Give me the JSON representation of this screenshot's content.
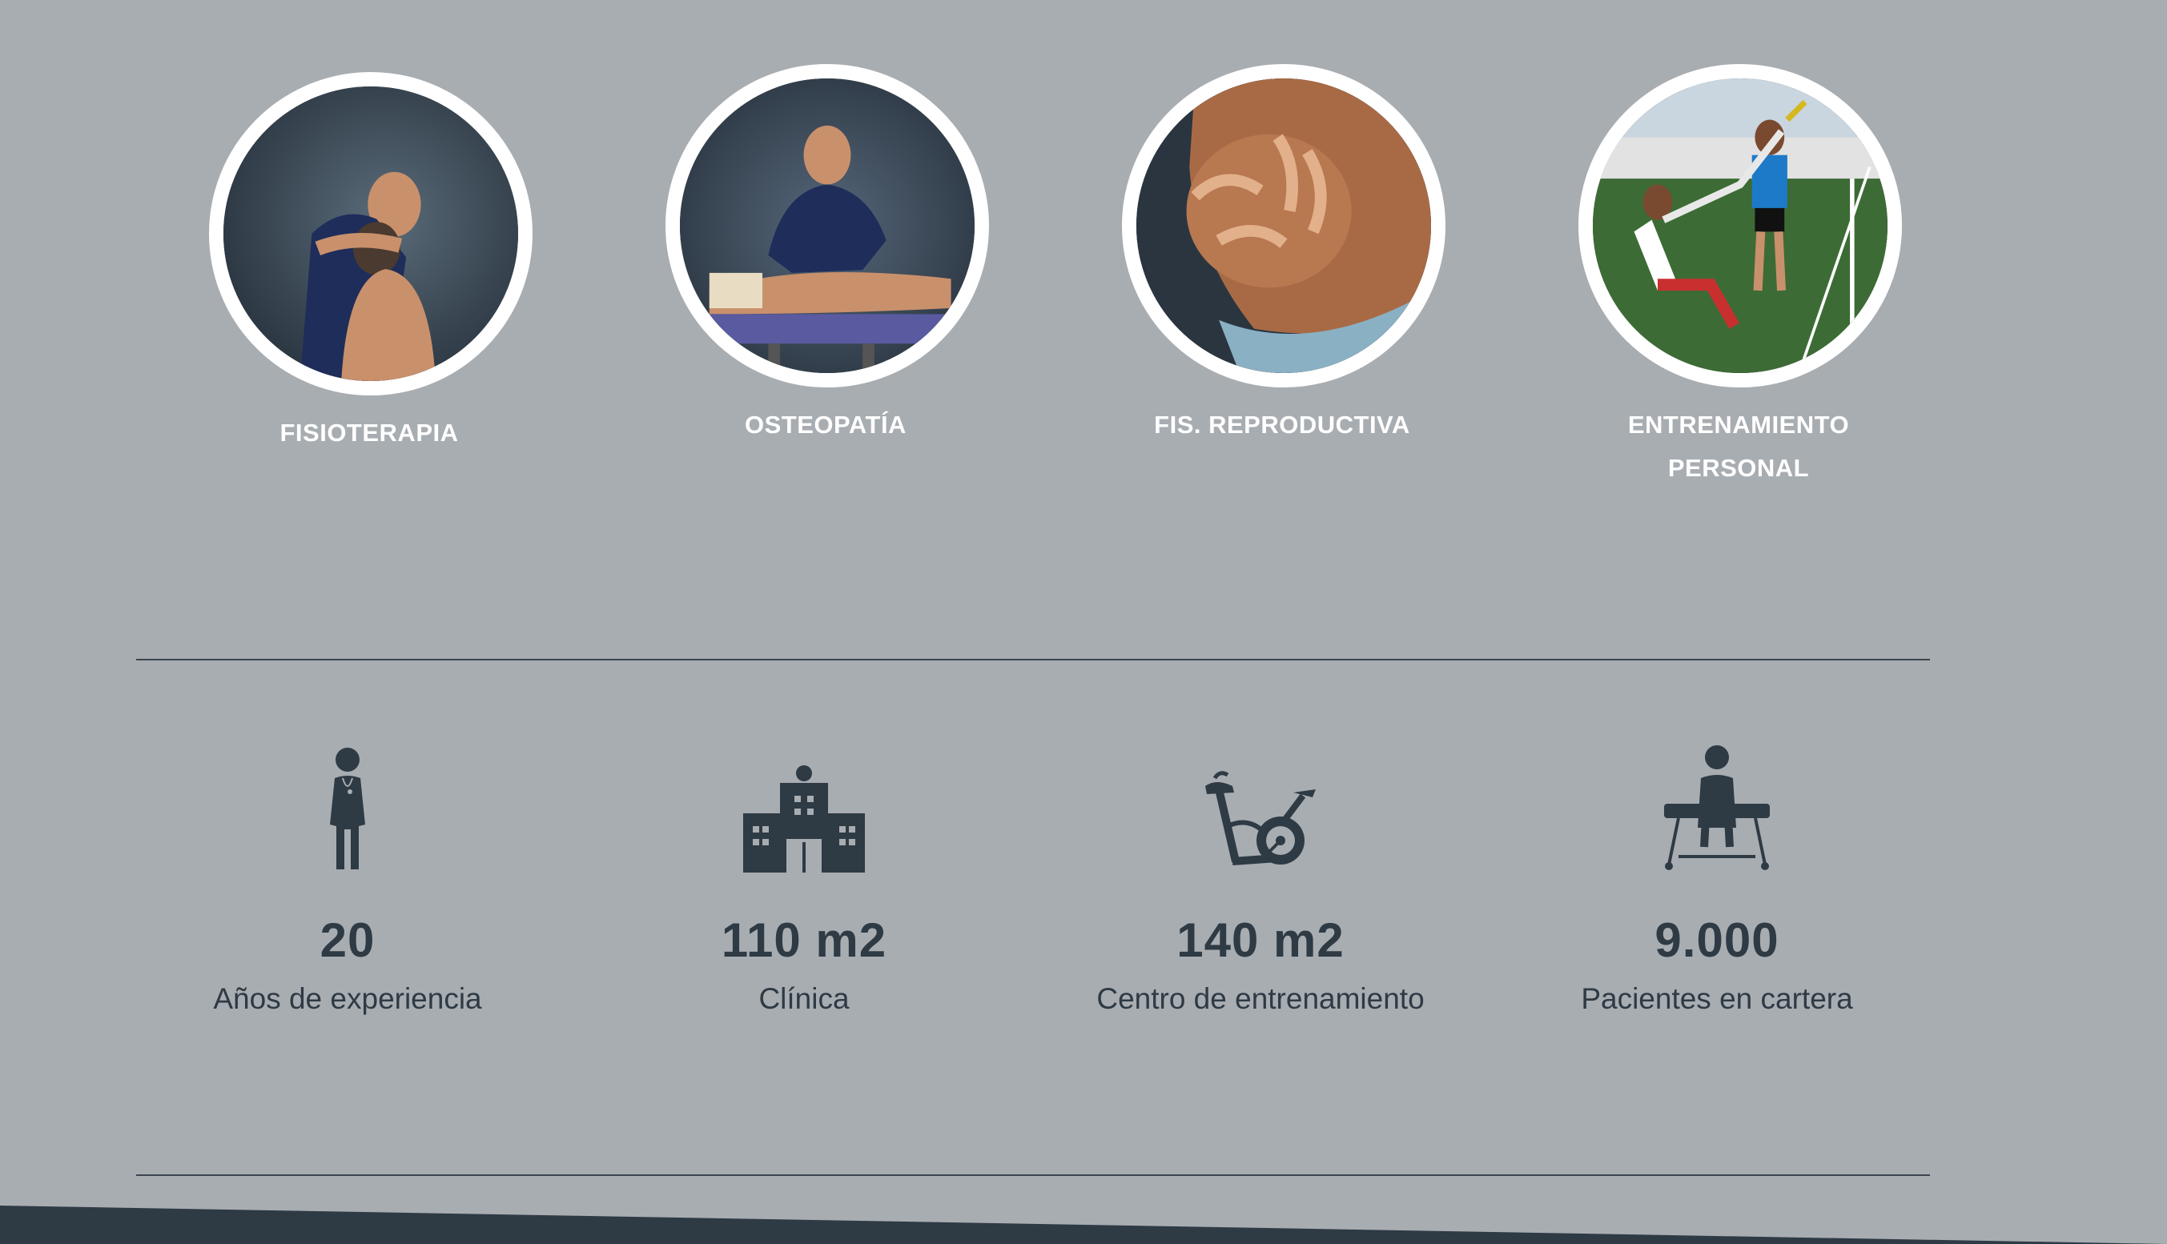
{
  "services": [
    {
      "title": "FISIOTERAPIA",
      "image": "physio-shoulder-treatment"
    },
    {
      "title": "OSTEOPATÍA",
      "image": "osteopathy-back-treatment"
    },
    {
      "title": "FIS. REPRODUCTIVA",
      "image": "pregnant-belly"
    },
    {
      "title": "ENTRENAMIENTO PERSONAL",
      "image": "outdoor-personal-training"
    }
  ],
  "stats": [
    {
      "value": "20",
      "label": "Años de experiencia",
      "icon": "doctor-icon"
    },
    {
      "value": "110 m2",
      "label": "Clínica",
      "icon": "clinic-building-icon"
    },
    {
      "value": "140 m2",
      "label": "Centro de entrenamiento",
      "icon": "exercise-bike-icon"
    },
    {
      "value": "9.000",
      "label": "Pacientes en cartera",
      "icon": "patient-table-icon"
    }
  ],
  "colors": {
    "background": "#a8adb2",
    "dark": "#2e3a44",
    "white": "#ffffff"
  }
}
